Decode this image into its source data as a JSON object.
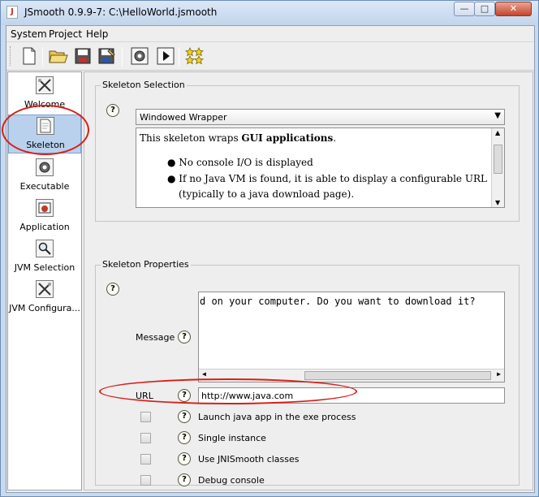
{
  "window": {
    "title": "JSmooth 0.9.9-7: C:\\HelloWorld.jsmooth",
    "app_icon": "J",
    "minimize_glyph": "—",
    "maximize_glyph": "□",
    "close_glyph": "✕"
  },
  "menu": {
    "items": [
      "System",
      "Project",
      "Help"
    ]
  },
  "toolbar": {
    "icons": [
      "new-file-icon",
      "open-folder-icon",
      "save-icon",
      "save-as-icon",
      "compile-icon",
      "run-icon",
      "about-stars-icon"
    ]
  },
  "nav": {
    "items": [
      {
        "label": "Welcome",
        "icon": "welcome-tools-icon"
      },
      {
        "label": "Skeleton",
        "icon": "skeleton-page-icon",
        "selected": true
      },
      {
        "label": "Executable",
        "icon": "executable-gear-icon"
      },
      {
        "label": "Application",
        "icon": "application-icon"
      },
      {
        "label": "JVM Selection",
        "icon": "jvm-search-icon"
      },
      {
        "label": "JVM Configura...",
        "icon": "jvm-config-icon"
      }
    ]
  },
  "skeleton_selection": {
    "title": "Skeleton Selection",
    "help_glyph": "?",
    "selected_skeleton": "Windowed Wrapper",
    "description_prefix": "This skeleton wraps ",
    "description_bold": "GUI applications",
    "description_suffix": ".",
    "bullets": [
      "No console I/O is displayed",
      "If no Java VM is found, it is able to display a configurable URL",
      "(typically to a java download page)."
    ]
  },
  "skeleton_properties": {
    "title": "Skeleton Properties",
    "message_label": "Message",
    "message_value": "d on your computer. Do you want to download it?",
    "url_label": "URL",
    "url_value": "http://www.java.com",
    "checkboxes": [
      {
        "label": "Launch java app in the exe process",
        "checked": false
      },
      {
        "label": "Single instance",
        "checked": false
      },
      {
        "label": "Use JNISmooth classes",
        "checked": false
      },
      {
        "label": "Debug console",
        "checked": false
      }
    ]
  },
  "colors": {
    "annotation_red": "#d91e18",
    "selection_blue": "#b9d1ec"
  }
}
